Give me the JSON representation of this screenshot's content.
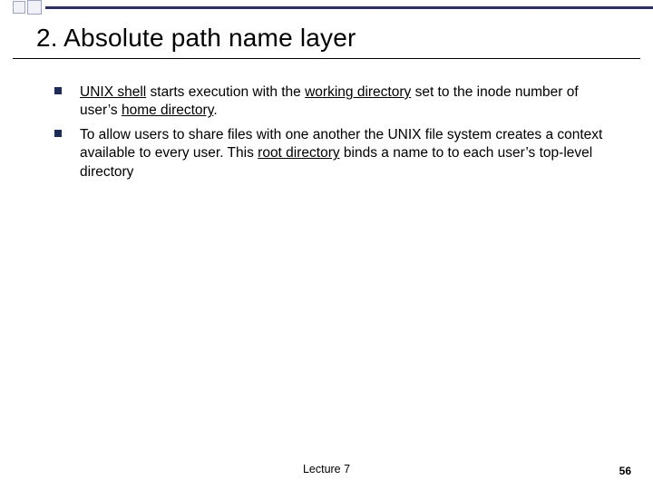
{
  "slide": {
    "title": "2.  Absolute path name layer",
    "bullets": [
      {
        "runs": [
          {
            "t": "UNIX shell",
            "u": true
          },
          {
            "t": " starts execution with the ",
            "u": false
          },
          {
            "t": "working directory",
            "u": true
          },
          {
            "t": " set to the inode number of user’s ",
            "u": false
          },
          {
            "t": "home directory",
            "u": true
          },
          {
            "t": ".",
            "u": false
          }
        ]
      },
      {
        "runs": [
          {
            "t": "To allow users to share files with one another the UNIX file system creates a context available to every user. This ",
            "u": false
          },
          {
            "t": "root directory",
            "u": true
          },
          {
            "t": " binds a name to to each user’s top-level directory",
            "u": false
          }
        ]
      }
    ],
    "footer_center": "Lecture 7",
    "page_number": "56"
  }
}
